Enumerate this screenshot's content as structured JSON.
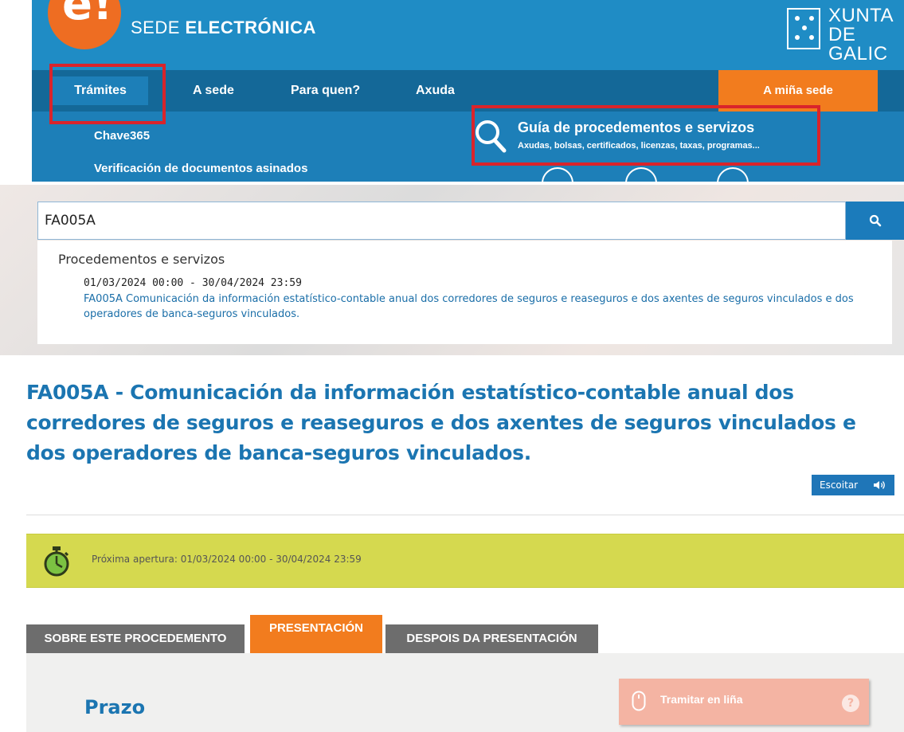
{
  "header": {
    "logo_letter": "e!",
    "title_prefix": "SEDE ",
    "title_bold": "ELECTRÓNICA",
    "xunta_line1": "XUNTA",
    "xunta_line2": "DE GALIC",
    "nav": {
      "tramites": "Trámites",
      "sede": "A sede",
      "para_quen": "Para quen?",
      "axuda": "Axuda",
      "minha_sede": "A miña sede"
    },
    "submenu": {
      "chave365": "Chave365",
      "verificacion": "Verificación de documentos asinados"
    },
    "guia": {
      "title": "Guía de procedementos e servizos",
      "subtitle": "Axudas, bolsas, certificados, licenzas, taxas, programas..."
    },
    "highlight_color": "#d9242b",
    "brand_blue": "#1f8cc5",
    "accent_orange": "#f27c1e"
  },
  "search": {
    "query": "FA005A",
    "button_icon": "search-icon",
    "results_heading": "Procedementos e servizos",
    "results": [
      {
        "date_range": "01/03/2024 00:00 - 30/04/2024 23:59",
        "title": "FA005A Comunicación da información estatístico-contable anual dos corredores de seguros e reaseguros e dos axentes de seguros vinculados e dos operadores de banca-seguros vinculados."
      }
    ]
  },
  "procedure": {
    "title": "FA005A - Comunicación da información estatístico-contable anual dos corredores de seguros e reaseguros e dos axentes de seguros vinculados e dos operadores de banca-seguros vinculados.",
    "listen_label": "Escoitar",
    "notice_text": "Próxima apertura:  01/03/2024 00:00 - 30/04/2024 23:59",
    "notice_color": "#d5d94f",
    "tabs": [
      {
        "label": "SOBRE ESTE PROCEDEMENTO",
        "active": false
      },
      {
        "label": "PRESENTACIÓN",
        "active": true
      },
      {
        "label": "DESPOIS DA PRESENTACIÓN",
        "active": false
      }
    ],
    "section_heading": "Prazo",
    "tramitar_label": "Tramitar en liña",
    "help_label": "?"
  }
}
